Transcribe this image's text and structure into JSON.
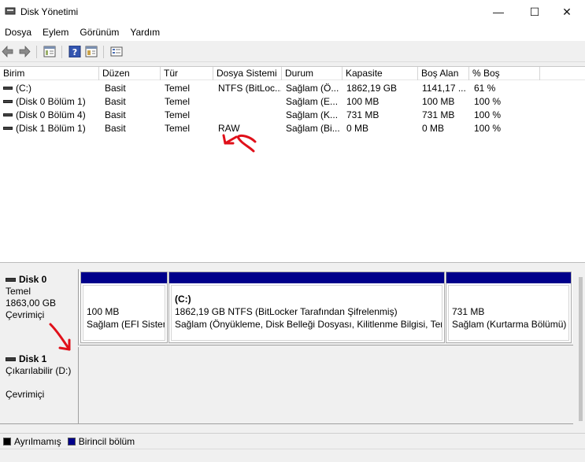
{
  "window": {
    "title": "Disk Yönetimi",
    "minimize_glyph": "—",
    "maximize_glyph": "☐",
    "close_glyph": "✕"
  },
  "menu": [
    "Dosya",
    "Eylem",
    "Görünüm",
    "Yardım"
  ],
  "toolbar": {
    "icons": [
      "back-icon",
      "forward-icon",
      "console-tree-icon",
      "help-icon",
      "properties-icon",
      "settings-icon"
    ]
  },
  "volumes": {
    "headers": [
      "Birim",
      "Düzen",
      "Tür",
      "Dosya Sistemi",
      "Durum",
      "Kapasite",
      "Boş Alan",
      "% Boş"
    ],
    "rows": [
      [
        "(C:)",
        "Basit",
        "Temel",
        "NTFS (BitLoc...",
        "Sağlam (Ö...",
        "1862,19 GB",
        "1141,17 ...",
        "61 %"
      ],
      [
        "(Disk 0 Bölüm 1)",
        "Basit",
        "Temel",
        "",
        "Sağlam (E...",
        "100 MB",
        "100 MB",
        "100 %"
      ],
      [
        "(Disk 0 Bölüm 4)",
        "Basit",
        "Temel",
        "",
        "Sağlam (K...",
        "731 MB",
        "731 MB",
        "100 %"
      ],
      [
        "(Disk 1 Bölüm 1)",
        "Basit",
        "Temel",
        "RAW",
        "Sağlam (Bi...",
        "0 MB",
        "0 MB",
        "100 %"
      ]
    ]
  },
  "disks": [
    {
      "name": "Disk 0",
      "type": "Temel",
      "size": "1863,00 GB",
      "status": "Çevrimiçi",
      "partitions": [
        {
          "title": "",
          "line1": "100 MB",
          "line2": "Sağlam (EFI Sistem Bölümü)"
        },
        {
          "title": "(C:)",
          "line1": "1862,19 GB NTFS (BitLocker Tarafından Şifrelenmiş)",
          "line2": "Sağlam (Önyükleme, Disk Belleği Dosyası, Kilitlenme Bilgisi, Temel Veri Bölümü)"
        },
        {
          "title": "",
          "line1": "731 MB",
          "line2": "Sağlam (Kurtarma Bölümü)"
        }
      ]
    },
    {
      "name": "Disk 1",
      "type": "Çıkarılabilir (D:)",
      "size": "",
      "status": "Çevrimiçi",
      "partitions": []
    }
  ],
  "legend": [
    {
      "label": "Ayrılmamış",
      "color": "#000000"
    },
    {
      "label": "Birincil bölüm",
      "color": "#00008b"
    }
  ],
  "colors": {
    "partition_bar": "#00008b",
    "annotation": "#e0101a"
  }
}
